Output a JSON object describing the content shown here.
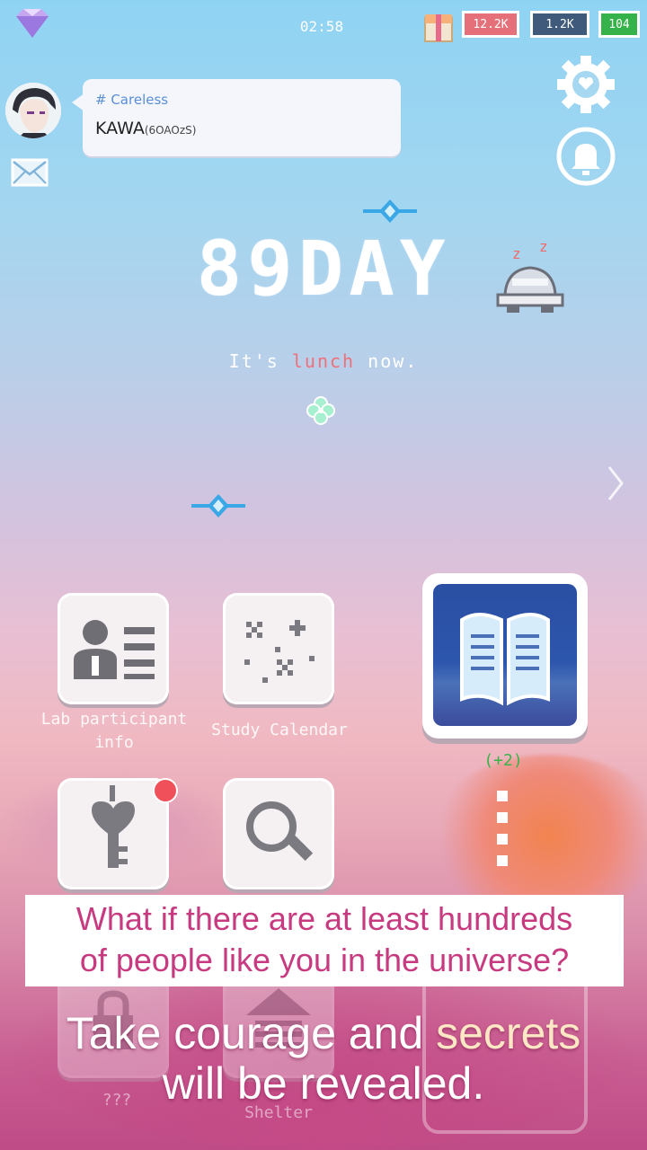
{
  "status_bar": {
    "time": "02:58",
    "stat_1": "12.2K",
    "stat_2": "1.2K",
    "stat_3": "104"
  },
  "message": {
    "tag": "# Careless",
    "name": "KAWA",
    "code": "(6OAOzS)"
  },
  "center": {
    "day_counter": "89DAY",
    "status_prefix": "It's ",
    "status_highlight": "lunch",
    "status_suffix": " now."
  },
  "apps": {
    "lab_info_label": "Lab participant info",
    "calendar_label": "Study Calendar",
    "book_badge": "(+2)",
    "locked_label": "???",
    "shelter_label": "Shelter"
  },
  "captions": {
    "line1a": "What if there are at least hundreds",
    "line1b": "of people like you in the universe?",
    "line2_prefix": "Take courage and ",
    "line2_highlight": "secrets",
    "line2_suffix": "will be revealed."
  },
  "colors": {
    "accent_pink": "#c73a80",
    "highlight_red": "#f0707a",
    "notification_red": "#f0505a",
    "book_blue": "#2a4fa3"
  }
}
